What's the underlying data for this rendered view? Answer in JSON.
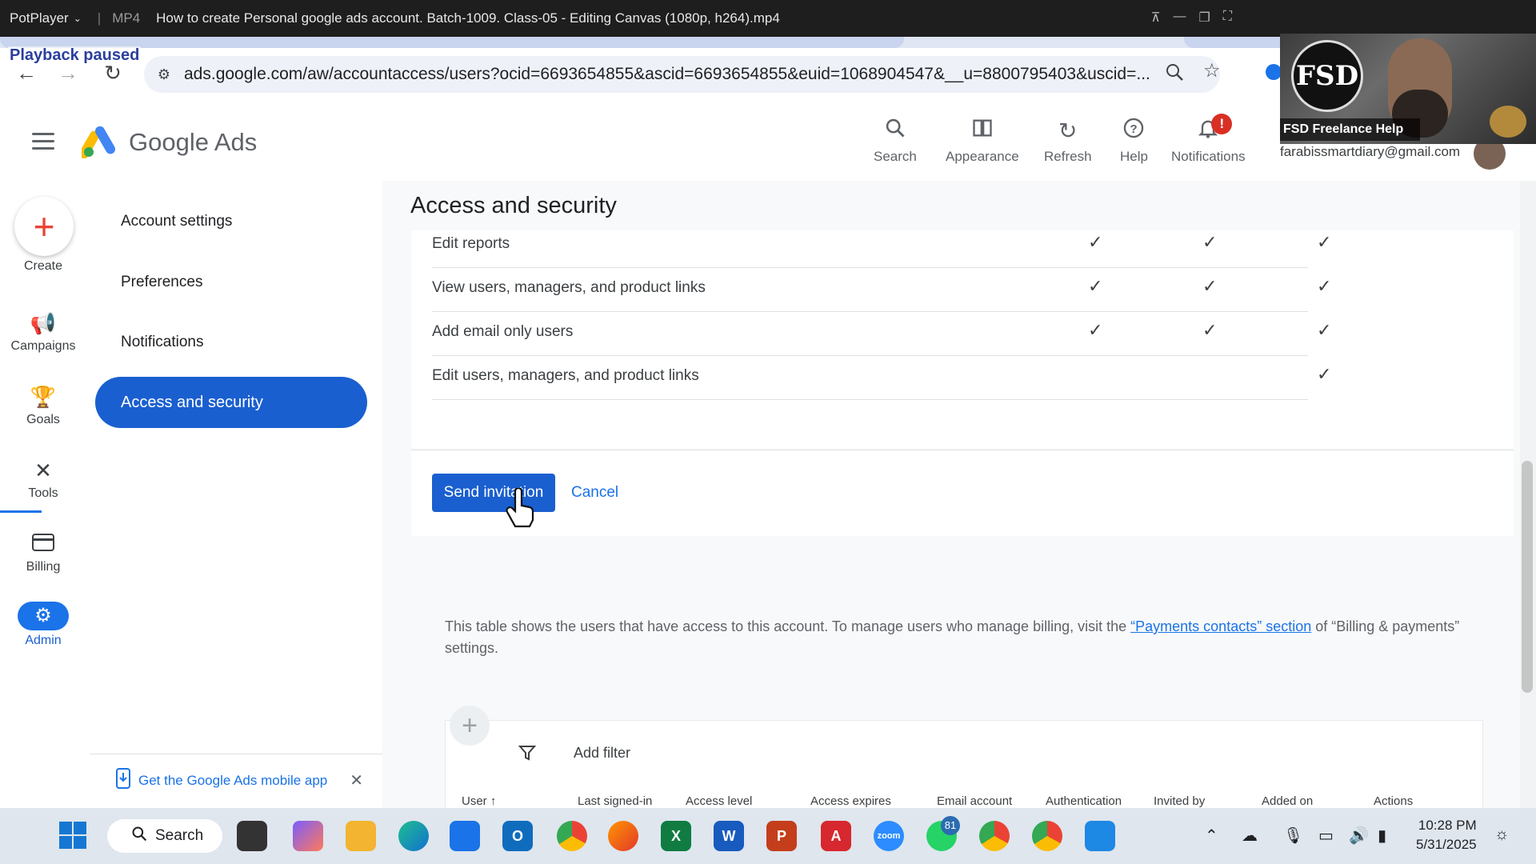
{
  "player": {
    "name": "PotPlayer",
    "format": "MP4",
    "title": "How to create Personal google ads account. Batch-1009. Class-05 - Editing Canvas (1080p, h264).mp4",
    "status": "Playback paused"
  },
  "browser": {
    "url": "ads.google.com/aw/accountaccess/users?ocid=6693654855&ascid=6693654855&euid=1068904547&__u=8800795403&uscid=..."
  },
  "webcam": {
    "label": "FSD Freelance Help",
    "logo_text": "FSD"
  },
  "header": {
    "app_name": "Google Ads",
    "buttons": {
      "search": "Search",
      "appearance": "Appearance",
      "refresh": "Refresh",
      "help": "Help",
      "notifications": "Notifications"
    },
    "notif_badge": "!",
    "account_email": "farabissmartdiary@gmail.com"
  },
  "rail": {
    "create": "Create",
    "campaigns": "Campaigns",
    "goals": "Goals",
    "tools": "Tools",
    "billing": "Billing",
    "admin": "Admin"
  },
  "subnav": {
    "items": [
      "Account settings",
      "Preferences",
      "Notifications"
    ],
    "active": "Access and security",
    "promo": "Get the Google Ads mobile app"
  },
  "main": {
    "title": "Access and security",
    "permissions": [
      {
        "label": "Edit reports",
        "checks": [
          true,
          true,
          true
        ]
      },
      {
        "label": "View users, managers, and product links",
        "checks": [
          true,
          true,
          true
        ]
      },
      {
        "label": "Add email only users",
        "checks": [
          true,
          true,
          true
        ]
      },
      {
        "label": "Edit users, managers, and product links",
        "checks": [
          false,
          false,
          true
        ]
      }
    ],
    "send_label": "Send invitation",
    "cancel_label": "Cancel",
    "info_before": "This table shows the users that have access to this account. To manage users who manage billing, visit the ",
    "info_link": "“Payments contacts” section",
    "info_after": " of “Billing & payments” settings.",
    "filter_label": "Add filter",
    "columns": [
      "User",
      "Last signed-in",
      "Access level",
      "Access expires",
      "Email account",
      "Authentication",
      "Invited by",
      "Added on",
      "Actions"
    ]
  },
  "taskbar": {
    "search_label": "Search",
    "whatsapp_badge": "81",
    "time": "10:28 PM",
    "date": "5/31/2025"
  }
}
